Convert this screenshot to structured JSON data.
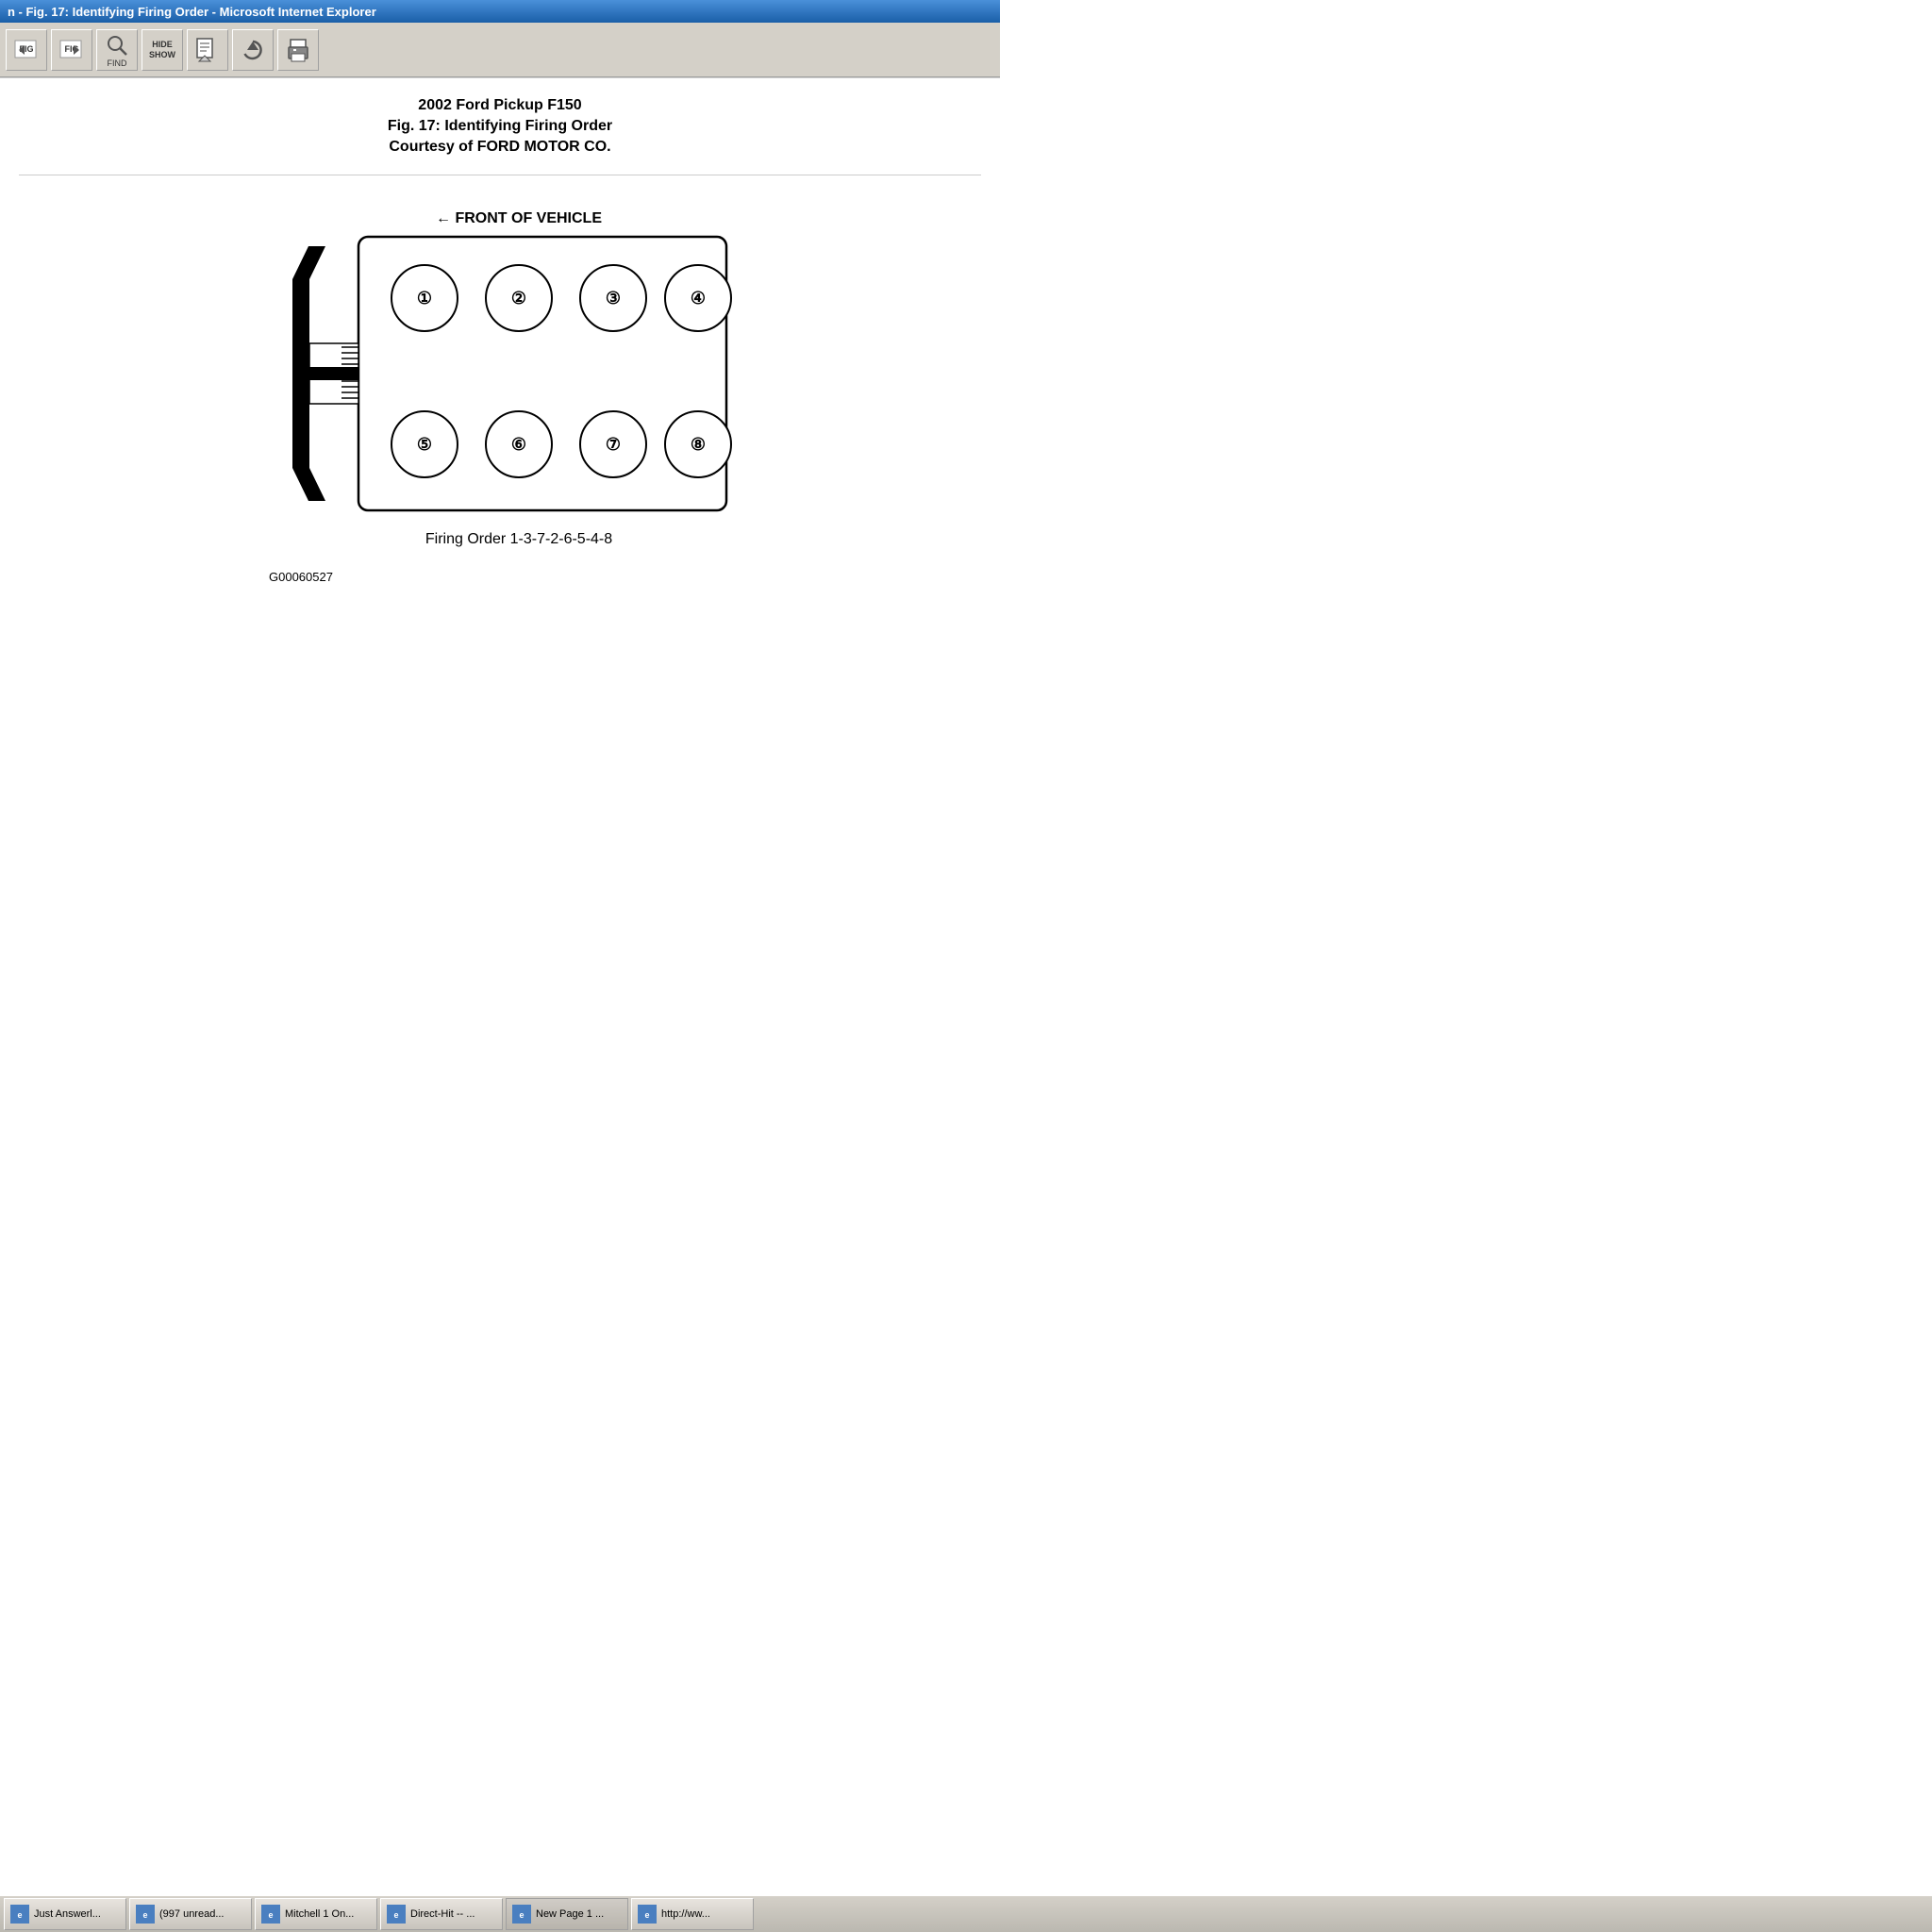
{
  "titlebar": {
    "text": "n - Fig. 17: Identifying Firing Order - Microsoft Internet Explorer"
  },
  "toolbar": {
    "buttons": [
      {
        "id": "prev-fig",
        "label": "FIG",
        "icon": "prev"
      },
      {
        "id": "next-fig",
        "label": "FIG",
        "icon": "next"
      },
      {
        "id": "find",
        "label": "FIND",
        "icon": "search"
      },
      {
        "id": "hide-show",
        "label": "HIDE SHOW",
        "icon": "toggle"
      },
      {
        "id": "bookmark",
        "label": "",
        "icon": "bookmark"
      },
      {
        "id": "refresh",
        "label": "",
        "icon": "refresh"
      },
      {
        "id": "print",
        "label": "",
        "icon": "print"
      }
    ]
  },
  "document": {
    "title": "2002 Ford Pickup F150",
    "subtitle": "Fig. 17: Identifying Firing Order",
    "courtesy": "Courtesy of FORD MOTOR CO.",
    "diagram_label": "Firing Order 1-3-7-2-6-5-4-8",
    "diagram_id": "G00060527",
    "front_label": "← FRONT OF VEHICLE",
    "cylinders": [
      {
        "num": "①",
        "row": "top",
        "pos": 1
      },
      {
        "num": "②",
        "row": "top",
        "pos": 2
      },
      {
        "num": "③",
        "row": "top",
        "pos": 3
      },
      {
        "num": "④",
        "row": "top",
        "pos": 4
      },
      {
        "num": "⑤",
        "row": "bottom",
        "pos": 1
      },
      {
        "num": "⑥",
        "row": "bottom",
        "pos": 2
      },
      {
        "num": "⑦",
        "row": "bottom",
        "pos": 3
      },
      {
        "num": "⑧",
        "row": "bottom",
        "pos": 4
      }
    ]
  },
  "taskbar": {
    "buttons": [
      {
        "label": "Just Answerl...",
        "active": false
      },
      {
        "label": "(997 unread...",
        "active": false
      },
      {
        "label": "Mitchell 1 On...",
        "active": false
      },
      {
        "label": "Direct-Hit -- ...",
        "active": false
      },
      {
        "label": "New Page 1 ...",
        "active": true
      },
      {
        "label": "http://ww...",
        "active": false
      }
    ]
  }
}
